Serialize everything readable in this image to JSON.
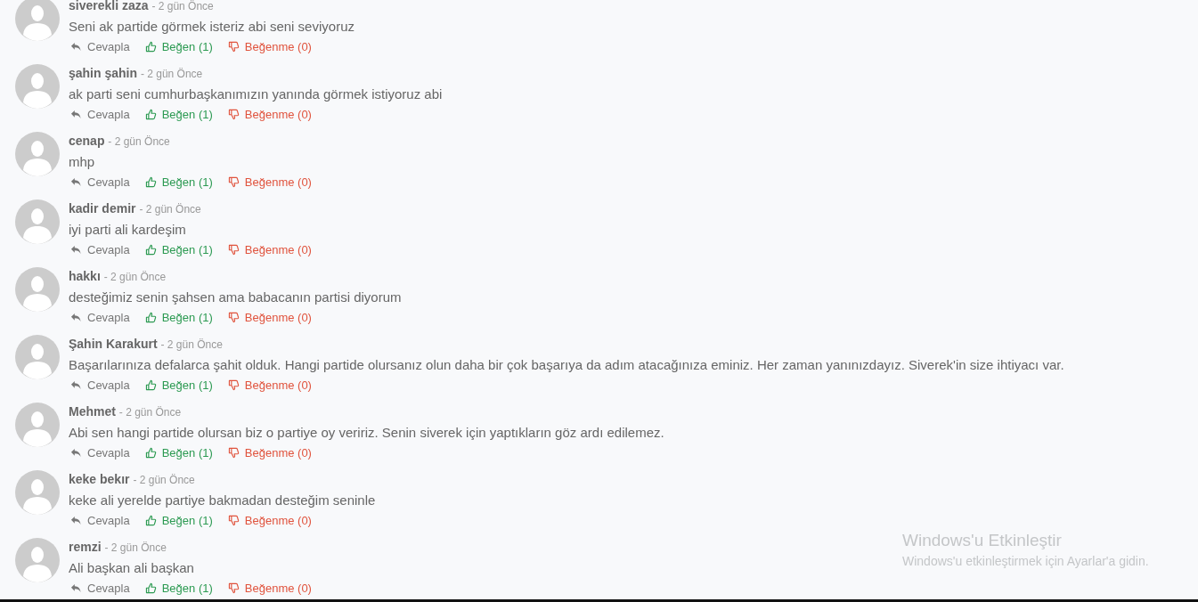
{
  "comments": [
    {
      "name": "siverekli zaza",
      "time": "- 2 gün Önce",
      "text": "Seni ak partide görmek isteriz abi seni seviyoruz",
      "actions": [
        {
          "kind": "reply",
          "label": "Cevapla"
        },
        {
          "kind": "like",
          "label": "Beğen (1)"
        },
        {
          "kind": "dislike",
          "label": "Beğenme (0)"
        }
      ]
    },
    {
      "name": "şahin şahin",
      "time": "- 2 gün Önce",
      "text": "ak parti seni cumhurbaşkanımızın yanında görmek istiyoruz abi",
      "actions": [
        {
          "kind": "reply",
          "label": "Cevapla"
        },
        {
          "kind": "like",
          "label": "Beğen (1)"
        },
        {
          "kind": "dislike",
          "label": "Beğenme (0)"
        }
      ]
    },
    {
      "name": "cenap",
      "time": "- 2 gün Önce",
      "text": "mhp",
      "actions": [
        {
          "kind": "reply",
          "label": "Cevapla"
        },
        {
          "kind": "like",
          "label": "Beğen (1)"
        },
        {
          "kind": "dislike",
          "label": "Beğenme (0)"
        }
      ]
    },
    {
      "name": "kadir demir",
      "time": "- 2 gün Önce",
      "text": "iyi parti ali kardeşim",
      "actions": [
        {
          "kind": "reply",
          "label": "Cevapla"
        },
        {
          "kind": "like",
          "label": "Beğen (1)"
        },
        {
          "kind": "dislike",
          "label": "Beğenme (0)"
        }
      ]
    },
    {
      "name": "hakkı",
      "time": "- 2 gün Önce",
      "text": "desteğimiz senin şahsen ama babacanın partisi diyorum",
      "actions": [
        {
          "kind": "reply",
          "label": "Cevapla"
        },
        {
          "kind": "like",
          "label": "Beğen (1)"
        },
        {
          "kind": "dislike",
          "label": "Beğenme (0)"
        }
      ]
    },
    {
      "name": "Şahin Karakurt",
      "time": "- 2 gün Önce",
      "text": "Başarılarınıza defalarca şahit olduk. Hangi partide olursanız olun daha bir çok başarıya da adım atacağınıza eminiz. Her zaman yanınızdayız. Siverek'in size ihtiyacı var.",
      "actions": [
        {
          "kind": "reply",
          "label": "Cevapla"
        },
        {
          "kind": "like",
          "label": "Beğen (1)"
        },
        {
          "kind": "dislike",
          "label": "Beğenme (0)"
        }
      ]
    },
    {
      "name": "Mehmet",
      "time": "- 2 gün Önce",
      "text": "Abi sen hangi partide olursan biz o partiye oy veririz. Senin siverek için yaptıkların göz ardı edilemez.",
      "actions": [
        {
          "kind": "reply",
          "label": "Cevapla"
        },
        {
          "kind": "like",
          "label": "Beğen (1)"
        },
        {
          "kind": "dislike",
          "label": "Beğenme (0)"
        }
      ]
    },
    {
      "name": "keke bekır",
      "time": "- 2 gün Önce",
      "text": "keke ali yerelde partiye bakmadan desteğim seninle",
      "actions": [
        {
          "kind": "reply",
          "label": "Cevapla"
        },
        {
          "kind": "like",
          "label": "Beğen (1)"
        },
        {
          "kind": "dislike",
          "label": "Beğenme (0)"
        }
      ]
    },
    {
      "name": "remzi",
      "time": "- 2 gün Önce",
      "text": "Ali başkan ali başkan",
      "actions": [
        {
          "kind": "reply",
          "label": "Cevapla"
        },
        {
          "kind": "like",
          "label": "Beğen (1)"
        },
        {
          "kind": "dislike",
          "label": "Beğenme (0)"
        }
      ]
    }
  ],
  "activation_notice": {
    "title": "Windows'u Etkinleştir",
    "message": "Windows'u etkinleştirmek için Ayarlar'a gidin."
  }
}
